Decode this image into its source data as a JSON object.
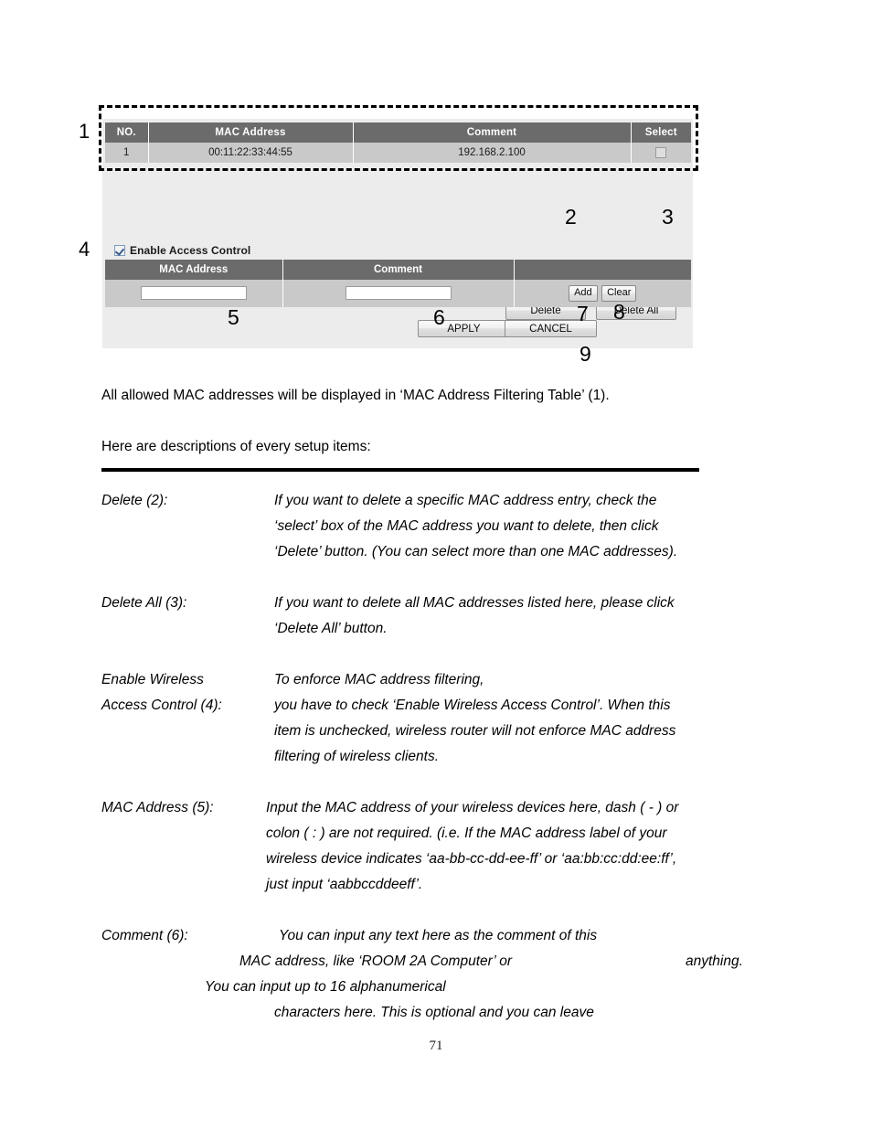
{
  "screenshot": {
    "callouts": {
      "c1": "1",
      "c2": "2",
      "c3": "3",
      "c4": "4",
      "c5": "5",
      "c6": "6",
      "c7": "7",
      "c8": "8",
      "c9": "9"
    },
    "filter_table": {
      "headers": [
        "NO.",
        "MAC Address",
        "Comment",
        "Select"
      ],
      "rows": [
        {
          "no": "1",
          "mac": "00:11:22:33:44:55",
          "comment": "192.168.2.100",
          "selected": false
        }
      ]
    },
    "table_buttons": {
      "delete": "Delete",
      "delete_all": "Delete All"
    },
    "access_control": {
      "label": "Enable Access Control",
      "checked": true
    },
    "add_table": {
      "headers": [
        "MAC Address",
        "Comment",
        ""
      ],
      "mac_value": "",
      "mac_placeholder": "",
      "comment_value": "",
      "comment_placeholder": "",
      "add_label": "Add",
      "clear_label": "Clear"
    },
    "form_buttons": {
      "apply": "APPLY",
      "cancel": "CANCEL"
    },
    "colors": {
      "header_bg": "#6b6b6b",
      "row_bg": "#c9c9c9",
      "panel_bg": "#ececec"
    }
  },
  "document": {
    "intro_1": "All allowed MAC addresses will be displayed in ‘MAC Address Filtering Table’ (1).",
    "intro_2": "Here are descriptions of every setup items:",
    "descriptions": [
      {
        "term": [
          "Delete (2):"
        ],
        "lines": [
          "If you want to delete a specific MAC address entry, check the",
          "‘select’ box of the MAC address you want to delete, then click",
          "‘Delete’ button. (You can select more than one MAC addresses)."
        ]
      },
      {
        "term": [
          "Delete All (3):"
        ],
        "lines": [
          "If you want to delete all MAC addresses listed here, please click",
          "‘Delete All’ button."
        ]
      },
      {
        "term": [
          "Enable Wireless",
          "Access Control (4):"
        ],
        "lines": [
          "To enforce MAC address filtering,",
          "you have to check ‘Enable Wireless Access Control’. When this",
          "item is unchecked, wireless router will not enforce MAC address",
          "filtering of wireless clients."
        ]
      },
      {
        "term": [
          "MAC Address (5):"
        ],
        "lines": [
          "Input the MAC address of your wireless devices here, dash ( - ) or",
          "colon ( : ) are not required. (i.e. If the MAC address label of your",
          "wireless device indicates ‘aa-bb-cc-dd-ee-ff’ or ‘aa:bb:cc:dd:ee:ff’,",
          "just input ‘aabbccddeeff’."
        ]
      },
      {
        "term": [
          "Comment (6):"
        ],
        "lines": [
          "You can input any text here as the comment of this",
          "MAC address, like ‘ROOM 2A Computer’ or",
          "anything.",
          "You can input up to 16 alphanumerical",
          "characters here. This is optional and you can leave"
        ]
      }
    ],
    "page_number": "71"
  }
}
